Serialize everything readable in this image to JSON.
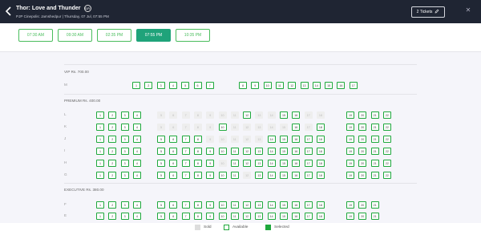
{
  "header": {
    "title": "Thor: Love and Thunder",
    "certificate": "UA",
    "subtitle": "PJP Cinepolis: Jamshedpur | Thursday, 07 Jul, 07:55 PM",
    "tickets_label": "2 Tickets"
  },
  "showtimes": [
    {
      "label": "07:30 AM",
      "selected": false
    },
    {
      "label": "09:30 AM",
      "selected": false
    },
    {
      "label": "02:35 PM",
      "selected": false
    },
    {
      "label": "07:55 PM",
      "selected": true
    },
    {
      "label": "10:35 PM",
      "selected": false
    }
  ],
  "sections": [
    {
      "label": "VIP Rs. 700.00"
    },
    {
      "label": "PREMIUM Rs. 400.00"
    },
    {
      "label": "EXECUTIVE Rs. 380.00"
    }
  ],
  "seat_rows": [
    {
      "row": "M",
      "section": 0,
      "blocks": [
        {
          "seats": [
            [
              "1",
              "a"
            ],
            [
              "2",
              "a"
            ],
            [
              "3",
              "a"
            ],
            [
              "4",
              "a"
            ],
            [
              "5",
              "a"
            ],
            [
              "6",
              "a"
            ],
            [
              "7",
              "a"
            ]
          ]
        },
        {
          "seats": [
            [
              "8",
              "a"
            ],
            [
              "9",
              "a"
            ],
            [
              "10",
              "a"
            ],
            [
              "11",
              "a"
            ],
            [
              "12",
              "a"
            ],
            [
              "13",
              "a"
            ],
            [
              "14",
              "a"
            ],
            [
              "15",
              "a"
            ],
            [
              "16",
              "a"
            ],
            [
              "17",
              "a"
            ]
          ]
        }
      ]
    },
    {
      "row": "L",
      "section": 1,
      "blocks": [
        {
          "seats": [
            [
              "1",
              "a"
            ],
            [
              "2",
              "a"
            ],
            [
              "3",
              "a"
            ],
            [
              "4",
              "a"
            ]
          ]
        },
        {
          "seats": [
            [
              "5",
              "s"
            ],
            [
              "6",
              "s"
            ],
            [
              "7",
              "s"
            ],
            [
              "8",
              "s"
            ],
            [
              "9",
              "s"
            ],
            [
              "10",
              "s"
            ],
            [
              "11",
              "s"
            ],
            [
              "12",
              "a"
            ],
            [
              "13",
              "s"
            ],
            [
              "14",
              "s"
            ],
            [
              "15",
              "a"
            ],
            [
              "16",
              "a"
            ],
            [
              "17",
              "s"
            ],
            [
              "18",
              "s"
            ]
          ]
        },
        {
          "seats": [
            [
              "19",
              "a"
            ],
            [
              "20",
              "a"
            ],
            [
              "21",
              "a"
            ],
            [
              "22",
              "a"
            ]
          ]
        }
      ]
    },
    {
      "row": "K",
      "section": 1,
      "blocks": [
        {
          "seats": [
            [
              "1",
              "a"
            ],
            [
              "2",
              "a"
            ],
            [
              "3",
              "a"
            ],
            [
              "4",
              "a"
            ]
          ]
        },
        {
          "seats": [
            [
              "5",
              "s"
            ],
            [
              "6",
              "s"
            ],
            [
              "7",
              "s"
            ],
            [
              "8",
              "s"
            ],
            [
              "9",
              "s"
            ],
            [
              "10",
              "a"
            ],
            [
              "11",
              "s"
            ],
            [
              "12",
              "s"
            ],
            [
              "13",
              "s"
            ],
            [
              "14",
              "s"
            ],
            [
              "15",
              "s"
            ],
            [
              "16",
              "a"
            ],
            [
              "17",
              "s"
            ],
            [
              "18",
              "a"
            ]
          ]
        },
        {
          "seats": [
            [
              "19",
              "a"
            ],
            [
              "20",
              "a"
            ],
            [
              "21",
              "a"
            ],
            [
              "22",
              "a"
            ]
          ]
        }
      ]
    },
    {
      "row": "J",
      "section": 1,
      "blocks": [
        {
          "seats": [
            [
              "1",
              "a"
            ],
            [
              "2",
              "a"
            ],
            [
              "3",
              "a"
            ],
            [
              "4",
              "a"
            ]
          ]
        },
        {
          "seats": [
            [
              "5",
              "a"
            ],
            [
              "6",
              "a"
            ],
            [
              "7",
              "a"
            ],
            [
              "8",
              "a"
            ],
            [
              "9",
              "s"
            ],
            [
              "10",
              "s"
            ],
            [
              "11",
              "s"
            ],
            [
              "12",
              "s"
            ],
            [
              "13",
              "s"
            ],
            [
              "14",
              "a"
            ],
            [
              "15",
              "a"
            ],
            [
              "16",
              "a"
            ],
            [
              "17",
              "a"
            ],
            [
              "18",
              "a"
            ]
          ]
        },
        {
          "seats": [
            [
              "19",
              "a"
            ],
            [
              "20",
              "a"
            ],
            [
              "21",
              "a"
            ],
            [
              "22",
              "a"
            ]
          ]
        }
      ]
    },
    {
      "row": "I",
      "section": 1,
      "blocks": [
        {
          "seats": [
            [
              "1",
              "a"
            ],
            [
              "2",
              "a"
            ],
            [
              "3",
              "a"
            ],
            [
              "4",
              "a"
            ]
          ]
        },
        {
          "seats": [
            [
              "5",
              "a"
            ],
            [
              "6",
              "a"
            ],
            [
              "7",
              "a"
            ],
            [
              "8",
              "a"
            ],
            [
              "9",
              "a"
            ],
            [
              "10",
              "a"
            ],
            [
              "11",
              "a"
            ],
            [
              "12",
              "a"
            ],
            [
              "13",
              "a"
            ],
            [
              "14",
              "a"
            ],
            [
              "15",
              "a"
            ],
            [
              "16",
              "a"
            ],
            [
              "17",
              "a"
            ],
            [
              "18",
              "a"
            ]
          ]
        },
        {
          "seats": [
            [
              "19",
              "a"
            ],
            [
              "20",
              "a"
            ],
            [
              "21",
              "a"
            ],
            [
              "22",
              "a"
            ]
          ]
        }
      ]
    },
    {
      "row": "H",
      "section": 1,
      "blocks": [
        {
          "seats": [
            [
              "1",
              "a"
            ],
            [
              "2",
              "a"
            ],
            [
              "3",
              "a"
            ],
            [
              "4",
              "a"
            ]
          ]
        },
        {
          "seats": [
            [
              "5",
              "a"
            ],
            [
              "6",
              "a"
            ],
            [
              "7",
              "a"
            ],
            [
              "8",
              "a"
            ],
            [
              "9",
              "a"
            ],
            [
              "10",
              "s"
            ],
            [
              "11",
              "a"
            ],
            [
              "12",
              "a"
            ],
            [
              "13",
              "a"
            ],
            [
              "14",
              "a"
            ],
            [
              "15",
              "a"
            ],
            [
              "16",
              "a"
            ],
            [
              "17",
              "a"
            ],
            [
              "18",
              "a"
            ]
          ]
        },
        {
          "seats": [
            [
              "19",
              "a"
            ],
            [
              "20",
              "a"
            ],
            [
              "21",
              "a"
            ],
            [
              "22",
              "a"
            ]
          ]
        }
      ]
    },
    {
      "row": "G",
      "section": 1,
      "blocks": [
        {
          "seats": [
            [
              "1",
              "a"
            ],
            [
              "2",
              "a"
            ],
            [
              "3",
              "a"
            ],
            [
              "4",
              "a"
            ]
          ]
        },
        {
          "seats": [
            [
              "5",
              "a"
            ],
            [
              "6",
              "a"
            ],
            [
              "7",
              "a"
            ],
            [
              "8",
              "a"
            ],
            [
              "9",
              "a"
            ],
            [
              "10",
              "a"
            ],
            [
              "11",
              "a"
            ],
            [
              "12",
              "s"
            ],
            [
              "13",
              "a"
            ],
            [
              "14",
              "a"
            ],
            [
              "15",
              "a"
            ],
            [
              "16",
              "a"
            ],
            [
              "17",
              "a"
            ],
            [
              "18",
              "a"
            ]
          ]
        },
        {
          "seats": [
            [
              "19",
              "a"
            ],
            [
              "20",
              "a"
            ],
            [
              "21",
              "a"
            ],
            [
              "22",
              "a"
            ]
          ]
        }
      ]
    },
    {
      "row": "F",
      "section": 2,
      "blocks": [
        {
          "seats": [
            [
              "1",
              "a"
            ],
            [
              "2",
              "a"
            ],
            [
              "3",
              "a"
            ],
            [
              "4",
              "a"
            ]
          ]
        },
        {
          "seats": [
            [
              "5",
              "a"
            ],
            [
              "6",
              "a"
            ],
            [
              "7",
              "a"
            ],
            [
              "8",
              "a"
            ],
            [
              "9",
              "a"
            ],
            [
              "10",
              "a"
            ],
            [
              "11",
              "a"
            ],
            [
              "12",
              "a"
            ],
            [
              "13",
              "a"
            ],
            [
              "14",
              "a"
            ],
            [
              "15",
              "a"
            ],
            [
              "16",
              "a"
            ],
            [
              "17",
              "a"
            ],
            [
              "18",
              "a"
            ]
          ]
        },
        {
          "seats": [
            [
              "19",
              "a"
            ],
            [
              "20",
              "a"
            ],
            [
              "21",
              "a"
            ]
          ]
        }
      ]
    },
    {
      "row": "E",
      "section": 2,
      "blocks": [
        {
          "seats": [
            [
              "1",
              "a"
            ],
            [
              "2",
              "a"
            ],
            [
              "3",
              "a"
            ],
            [
              "4",
              "a"
            ]
          ]
        },
        {
          "seats": [
            [
              "5",
              "a"
            ],
            [
              "6",
              "a"
            ],
            [
              "7",
              "a"
            ],
            [
              "8",
              "a"
            ],
            [
              "9",
              "a"
            ],
            [
              "10",
              "a"
            ],
            [
              "11",
              "a"
            ],
            [
              "12",
              "a"
            ],
            [
              "13",
              "a"
            ],
            [
              "14",
              "a"
            ],
            [
              "15",
              "a"
            ],
            [
              "16",
              "a"
            ],
            [
              "17",
              "a"
            ],
            [
              "18",
              "a"
            ]
          ]
        },
        {
          "seats": [
            [
              "19",
              "a"
            ],
            [
              "20",
              "a"
            ],
            [
              "21",
              "a"
            ]
          ]
        }
      ]
    }
  ],
  "legend": {
    "sold": "Sold",
    "available": "Available",
    "selected": "Selected"
  },
  "colors": {
    "header_bg": "#1f2533",
    "accent": "#1fa37a",
    "seat_border": "#1ea83c",
    "sold": "#eeeeee"
  },
  "icons": {
    "back": "chevron-left-icon",
    "edit": "pencil-icon",
    "close": "close-icon"
  }
}
